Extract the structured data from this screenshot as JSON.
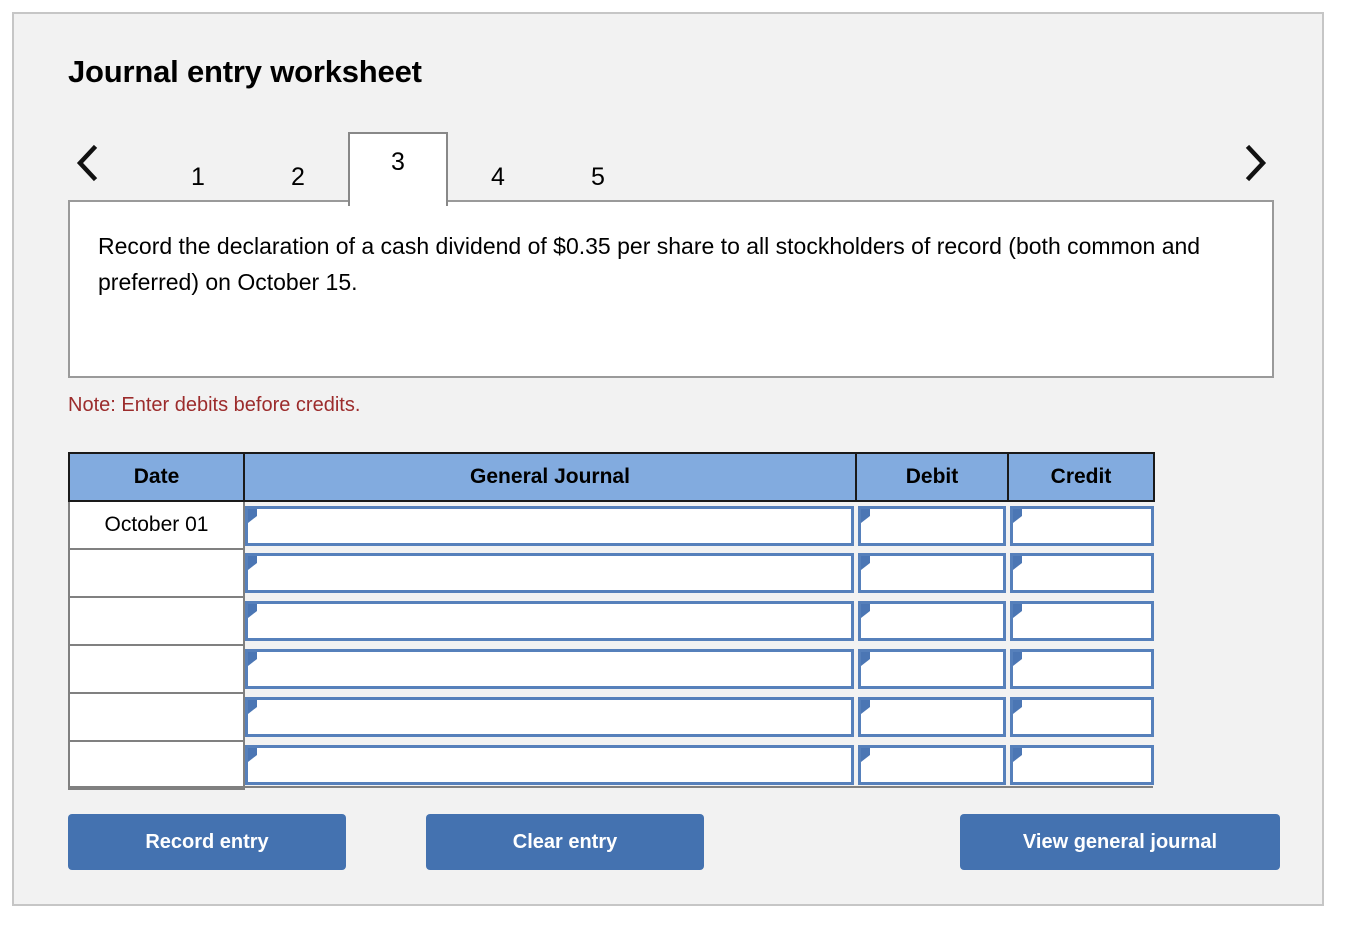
{
  "header": {
    "title": "Journal entry worksheet"
  },
  "tabstrip": {
    "prev_icon": "chevron-left-icon",
    "next_icon": "chevron-right-icon",
    "active_tab": "3",
    "tabs": [
      {
        "label": "1",
        "active": false
      },
      {
        "label": "2",
        "active": false
      },
      {
        "label": "3",
        "active": true
      },
      {
        "label": "4",
        "active": false
      },
      {
        "label": "5",
        "active": false
      }
    ]
  },
  "description": {
    "text": "Record the declaration of a cash dividend of $0.35 per share to all stockholders of record (both common and preferred) on October 15."
  },
  "note": {
    "text": "Note: Enter debits before credits."
  },
  "journal": {
    "columns": [
      {
        "key": "date",
        "label": "Date"
      },
      {
        "key": "gj",
        "label": "General Journal"
      },
      {
        "key": "debit",
        "label": "Debit"
      },
      {
        "key": "credit",
        "label": "Credit"
      }
    ],
    "rows": [
      {
        "date": "October 01",
        "gj": "",
        "debit": "",
        "credit": ""
      },
      {
        "date": "",
        "gj": "",
        "debit": "",
        "credit": ""
      },
      {
        "date": "",
        "gj": "",
        "debit": "",
        "credit": ""
      },
      {
        "date": "",
        "gj": "",
        "debit": "",
        "credit": ""
      },
      {
        "date": "",
        "gj": "",
        "debit": "",
        "credit": ""
      },
      {
        "date": "",
        "gj": "",
        "debit": "",
        "credit": ""
      }
    ]
  },
  "actions": {
    "record_label": "Record entry",
    "clear_label": "Clear entry",
    "view_label": "View general journal"
  },
  "colors": {
    "page_background": "#f2f2f2",
    "table_header_blue": "#82abdf",
    "input_border_blue": "#5680bb",
    "button_blue": "#4472b0",
    "note_red": "#9c2c2c",
    "card_border": "#c6c6c6"
  }
}
